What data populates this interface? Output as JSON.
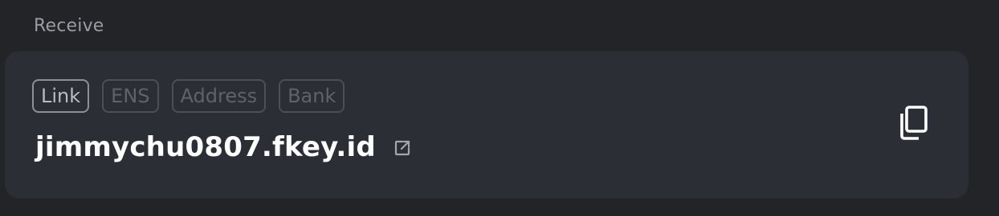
{
  "section": {
    "label": "Receive"
  },
  "receive": {
    "tabs": [
      {
        "label": "Link",
        "active": true
      },
      {
        "label": "ENS",
        "active": false
      },
      {
        "label": "Address",
        "active": false
      },
      {
        "label": "Bank",
        "active": false
      }
    ],
    "value": "jimmychu0807.fkey.id",
    "open_link_icon": "external-link-icon",
    "copy_icon": "copy-icon"
  },
  "colors": {
    "background": "#232428",
    "card": "#2c2e35",
    "text_primary": "#ffffff",
    "text_muted": "#9a9ca3"
  }
}
